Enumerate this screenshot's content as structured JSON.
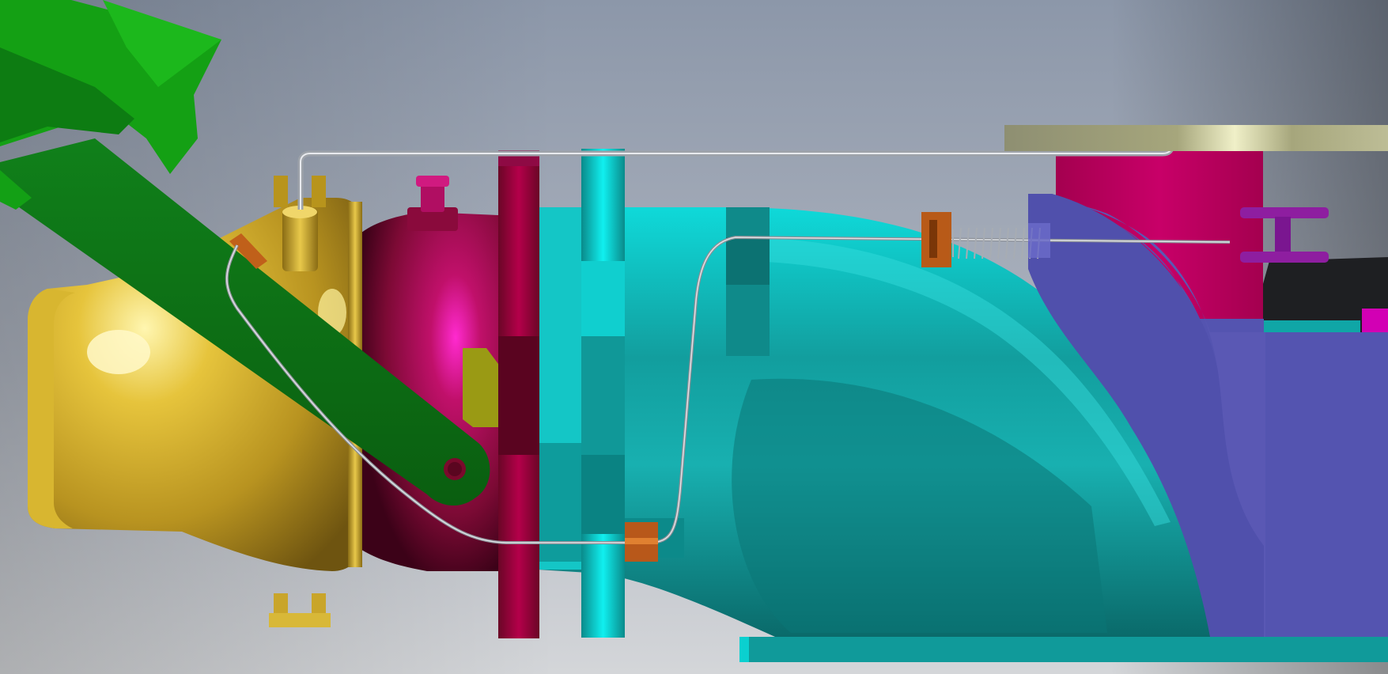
{
  "scene": {
    "background_top": "#8e98a8",
    "background_bottom": "#cfd2d6",
    "parts": [
      {
        "name": "throttle-body",
        "color": "#c9a52a"
      },
      {
        "name": "intake-plenum",
        "color": "#8a0d3a"
      },
      {
        "name": "intake-runner",
        "color": "#14b3b3"
      },
      {
        "name": "lever-arm",
        "color": "#0f7a14"
      },
      {
        "name": "bracket-block",
        "color": "#5554b0"
      },
      {
        "name": "mount-plate",
        "color": "#b8005e"
      },
      {
        "name": "spring",
        "color": "#9aa0a8"
      },
      {
        "name": "cable-clamp",
        "color": "#b85a18"
      },
      {
        "name": "i-beam-clip",
        "color": "#8d1c9a"
      }
    ]
  }
}
